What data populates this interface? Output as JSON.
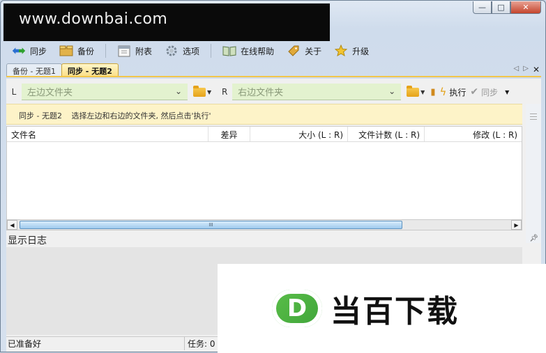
{
  "watermark": "www.downbai.com",
  "window": {
    "min": "—",
    "max": "□",
    "close": "✕"
  },
  "toolbar": {
    "sync_label": "同步",
    "backup_label": "备份",
    "schedule_label": "附表",
    "options_label": "选项",
    "help_label": "在线帮助",
    "about_label": "关于",
    "upgrade_label": "升级"
  },
  "tabs": [
    {
      "label": "备份 - 无题1",
      "active": false
    },
    {
      "label": "同步 - 无题2",
      "active": true
    }
  ],
  "folders": {
    "left_label": "L",
    "left_placeholder": "左边文件夹",
    "right_label": "R",
    "right_placeholder": "右边文件夹",
    "run_label": "执行",
    "sync_label": "同步"
  },
  "info": {
    "title": "同步 - 无题2",
    "message": "选择左边和右边的文件夹, 然后点击'执行'"
  },
  "columns": [
    "文件名",
    "差异",
    "大小 (L : R)",
    "文件计数 (L : R)",
    "修改 (L : R)"
  ],
  "log_title": "显示日志",
  "status": {
    "left": "已准备好",
    "right": "任务: 0"
  },
  "brand": {
    "logo_letter": "D",
    "name": "当百下载"
  },
  "icons": {
    "sync": "sync-arrows-icon",
    "backup": "backup-box-icon",
    "schedule": "calendar-icon",
    "options": "gear-icon",
    "help": "book-icon",
    "about": "tag-icon",
    "upgrade": "star-icon"
  },
  "colors": {
    "accent": "#f2c64a",
    "info_bg": "#fdf3c8",
    "folder_bg": "#e3f2cf",
    "brand_green": "#4fb343"
  }
}
